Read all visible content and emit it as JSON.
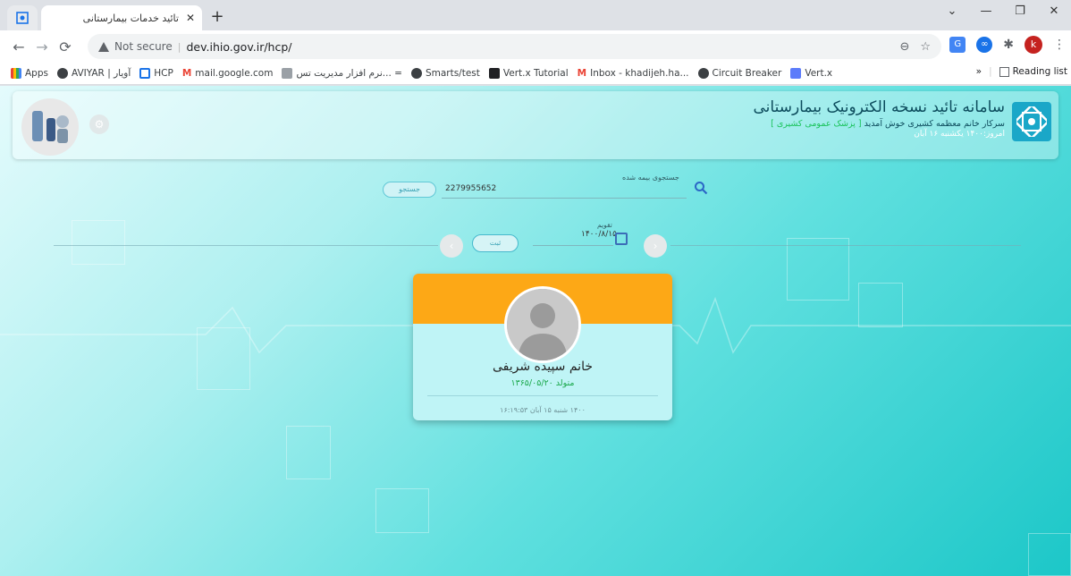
{
  "browser": {
    "tab_title": "تائید خدمات بیمارستانی",
    "tab_close": "✕",
    "new_tab": "+",
    "window_controls": {
      "chevron": "⌄",
      "minimize": "—",
      "restore": "❐",
      "close": "✕"
    },
    "not_secure": "Not secure",
    "url": "dev.ihio.gov.ir/hcp/",
    "profile_initial": "k"
  },
  "bookmarks": {
    "items": [
      {
        "label": "Apps",
        "color": "#ea4335"
      },
      {
        "label": "AVIYAR | آویار",
        "color": "#3c4043"
      },
      {
        "label": "HCP",
        "color": "#1a73e8"
      },
      {
        "label": "mail.google.com",
        "color": "#ea4335"
      },
      {
        "label": "نرم افزار مدیریت تس... =",
        "color": "#5f6368"
      },
      {
        "label": "Smarts/test",
        "color": "#3c4043"
      },
      {
        "label": "Vert.x Tutorial",
        "color": "#202124"
      },
      {
        "label": "Inbox - khadijeh.ha...",
        "color": "#ea4335"
      },
      {
        "label": "Circuit Breaker",
        "color": "#3c4043"
      },
      {
        "label": "Vert.x",
        "color": "#5c7cfa"
      }
    ],
    "more": "»",
    "reading_list": "Reading list"
  },
  "header": {
    "title": "سامانه تائید نسخه الکترونیک بیمارستانی",
    "welcome": "سرکار خانم معظمه کشیری خوش آمدید",
    "role": "[ پزشک عمومی کشیری ]",
    "today": "امروز:۱۴۰۰ یکشنبه ۱۶ آبان"
  },
  "search": {
    "label": "جستجوی بیمه شده",
    "value": "2279955652",
    "button": "جستجو"
  },
  "calendar": {
    "label": "تقویم",
    "value": "۱۴۰۰/۸/۱۵",
    "submit": "ثبت"
  },
  "patient_card": {
    "name": "خانم سپیده شریفی",
    "birth": "متولد ۱۳۶۵/۰۵/۲۰",
    "visit_datetime": "۱۴۰۰ شنبه ۱۵ آبان ۱۶:۱۹:۵۳"
  },
  "colors": {
    "card_top": "#fda816",
    "role_green": "#19c25a",
    "accent_teal": "#1aa7c8"
  }
}
